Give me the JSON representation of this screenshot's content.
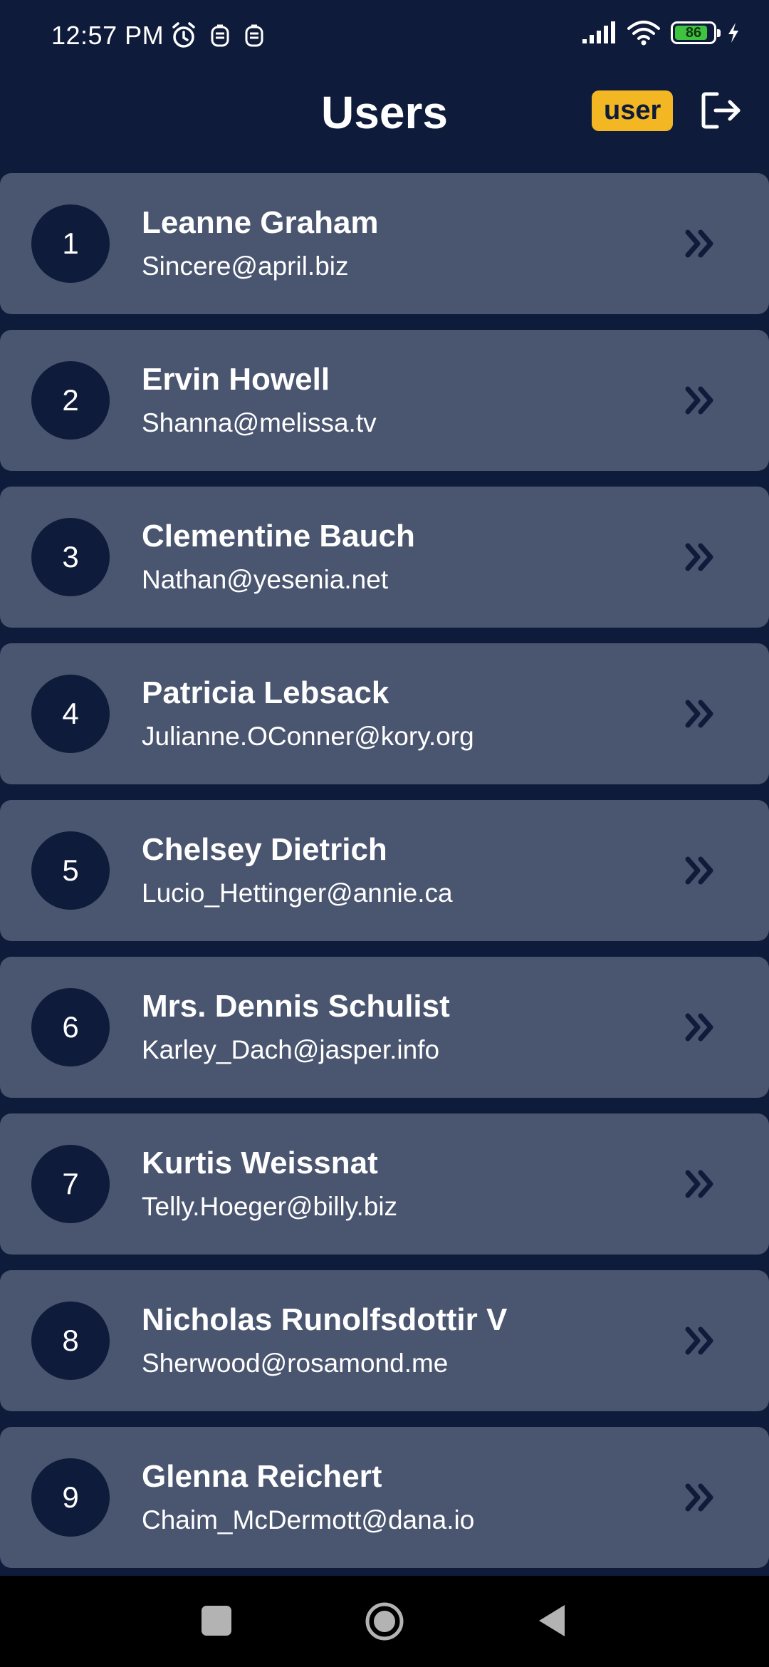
{
  "status_bar": {
    "time": "12:57 PM",
    "battery_level": "86",
    "icons": [
      "alarm-icon",
      "notification-icon",
      "notification-icon",
      "signal-icon",
      "wifi-icon",
      "battery-icon",
      "charging-icon"
    ]
  },
  "header": {
    "title": "Users",
    "role_badge": "user",
    "logout_icon": "logout-icon"
  },
  "users": [
    {
      "number": "1",
      "name": "Leanne Graham",
      "email": "Sincere@april.biz"
    },
    {
      "number": "2",
      "name": "Ervin Howell",
      "email": "Shanna@melissa.tv"
    },
    {
      "number": "3",
      "name": "Clementine Bauch",
      "email": "Nathan@yesenia.net"
    },
    {
      "number": "4",
      "name": "Patricia Lebsack",
      "email": "Julianne.OConner@kory.org"
    },
    {
      "number": "5",
      "name": "Chelsey Dietrich",
      "email": "Lucio_Hettinger@annie.ca"
    },
    {
      "number": "6",
      "name": "Mrs. Dennis Schulist",
      "email": "Karley_Dach@jasper.info"
    },
    {
      "number": "7",
      "name": "Kurtis Weissnat",
      "email": "Telly.Hoeger@billy.biz"
    },
    {
      "number": "8",
      "name": "Nicholas Runolfsdottir V",
      "email": "Sherwood@rosamond.me"
    },
    {
      "number": "9",
      "name": "Glenna Reichert",
      "email": "Chaim_McDermott@dana.io"
    }
  ],
  "colors": {
    "background": "#0f1b3a",
    "card": "#4a5570",
    "badge": "#f2b722",
    "text": "#ffffff",
    "chevron": "#0f1b3a"
  },
  "nav_bar": {
    "buttons": [
      "recents-button",
      "home-button",
      "back-button"
    ]
  }
}
